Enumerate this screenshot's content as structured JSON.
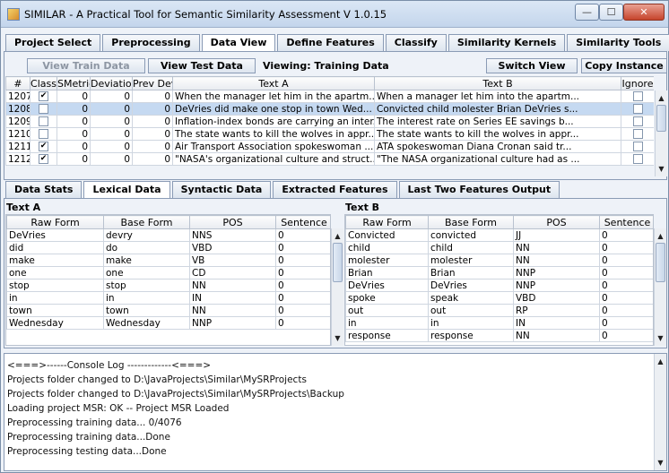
{
  "window": {
    "title": "SIMILAR - A Practical Tool for Semantic Similarity Assessment     V 1.0.15",
    "min_glyph": "—",
    "max_glyph": "☐",
    "close_glyph": "✕"
  },
  "main_tabs": [
    "Project Select",
    "Preprocessing",
    "Data View",
    "Define Features",
    "Classify",
    "Similarity Kernels",
    "Similarity Tools"
  ],
  "toolbar": {
    "view_train": "View Train Data",
    "view_test": "View Test Data",
    "viewing": "Viewing: Training Data",
    "switch_view": "Switch View",
    "copy_instance": "Copy Instance"
  },
  "data_table": {
    "columns": [
      "#",
      "Class",
      "SMetric",
      "Deviation",
      "Prev Dev",
      "Text A",
      "Text B",
      "Ignore"
    ],
    "rows": [
      {
        "id": "1207",
        "cls": true,
        "smetric": "0",
        "dev": "0",
        "prev": "0",
        "a": "When the manager let him in the apartm...",
        "b": "When a manager let him into the apartm...",
        "ignore": false
      },
      {
        "id": "1208",
        "cls": false,
        "smetric": "0",
        "dev": "0",
        "prev": "0",
        "a": "DeVries did make one stop in town Wed...",
        "b": "Convicted child molester Brian DeVries s...",
        "ignore": false
      },
      {
        "id": "1209",
        "cls": false,
        "smetric": "0",
        "dev": "0",
        "prev": "0",
        "a": "Inflation-index bonds are carrying an inter...",
        "b": "The interest rate on Series EE savings b...",
        "ignore": false
      },
      {
        "id": "1210",
        "cls": false,
        "smetric": "0",
        "dev": "0",
        "prev": "0",
        "a": "The state wants to kill the wolves in appr...",
        "b": "The state wants to kill the wolves in appr...",
        "ignore": false
      },
      {
        "id": "1211",
        "cls": true,
        "smetric": "0",
        "dev": "0",
        "prev": "0",
        "a": "Air Transport Association spokeswoman ...",
        "b": "ATA spokeswoman Diana Cronan said tr...",
        "ignore": false
      },
      {
        "id": "1212",
        "cls": true,
        "smetric": "0",
        "dev": "0",
        "prev": "0",
        "a": "\"NASA's organizational culture and struct...",
        "b": "\"The NASA organizational culture had as ...",
        "ignore": false
      }
    ]
  },
  "sub_tabs": [
    "Data Stats",
    "Lexical Data",
    "Syntactic Data",
    "Extracted Features",
    "Last Two Features Output"
  ],
  "text_a": {
    "label": "Text A",
    "columns": [
      "Raw Form",
      "Base Form",
      "POS",
      "Sentence"
    ],
    "rows": [
      [
        "DeVries",
        "devry",
        "NNS",
        "0"
      ],
      [
        "did",
        "do",
        "VBD",
        "0"
      ],
      [
        "make",
        "make",
        "VB",
        "0"
      ],
      [
        "one",
        "one",
        "CD",
        "0"
      ],
      [
        "stop",
        "stop",
        "NN",
        "0"
      ],
      [
        "in",
        "in",
        "IN",
        "0"
      ],
      [
        "town",
        "town",
        "NN",
        "0"
      ],
      [
        "Wednesday",
        "Wednesday",
        "NNP",
        "0"
      ]
    ]
  },
  "text_b": {
    "label": "Text B",
    "columns": [
      "Raw Form",
      "Base Form",
      "POS",
      "Sentence"
    ],
    "rows": [
      [
        "Convicted",
        "convicted",
        "JJ",
        "0"
      ],
      [
        "child",
        "child",
        "NN",
        "0"
      ],
      [
        "molester",
        "molester",
        "NN",
        "0"
      ],
      [
        "Brian",
        "Brian",
        "NNP",
        "0"
      ],
      [
        "DeVries",
        "DeVries",
        "NNP",
        "0"
      ],
      [
        "spoke",
        "speak",
        "VBD",
        "0"
      ],
      [
        "out",
        "out",
        "RP",
        "0"
      ],
      [
        "in",
        "in",
        "IN",
        "0"
      ],
      [
        "response",
        "response",
        "NN",
        "0"
      ]
    ]
  },
  "console": [
    "<===>------Console Log -------------<===>",
    "Projects folder changed to D:\\JavaProjects\\Similar\\MySRProjects",
    "Projects folder changed to D:\\JavaProjects\\Similar\\MySRProjects\\Backup",
    "Loading project MSR: OK -- Project MSR Loaded",
    "Preprocessing training data... 0/4076",
    "Preprocessing training data...Done",
    "Preprocessing testing data...Done"
  ],
  "glyphs": {
    "check": "✔",
    "up": "▲",
    "down": "▼"
  },
  "colors": {
    "selected_row": "#c5d9f1",
    "window_bg": "#eef2f8",
    "border": "#8a9bb5"
  }
}
